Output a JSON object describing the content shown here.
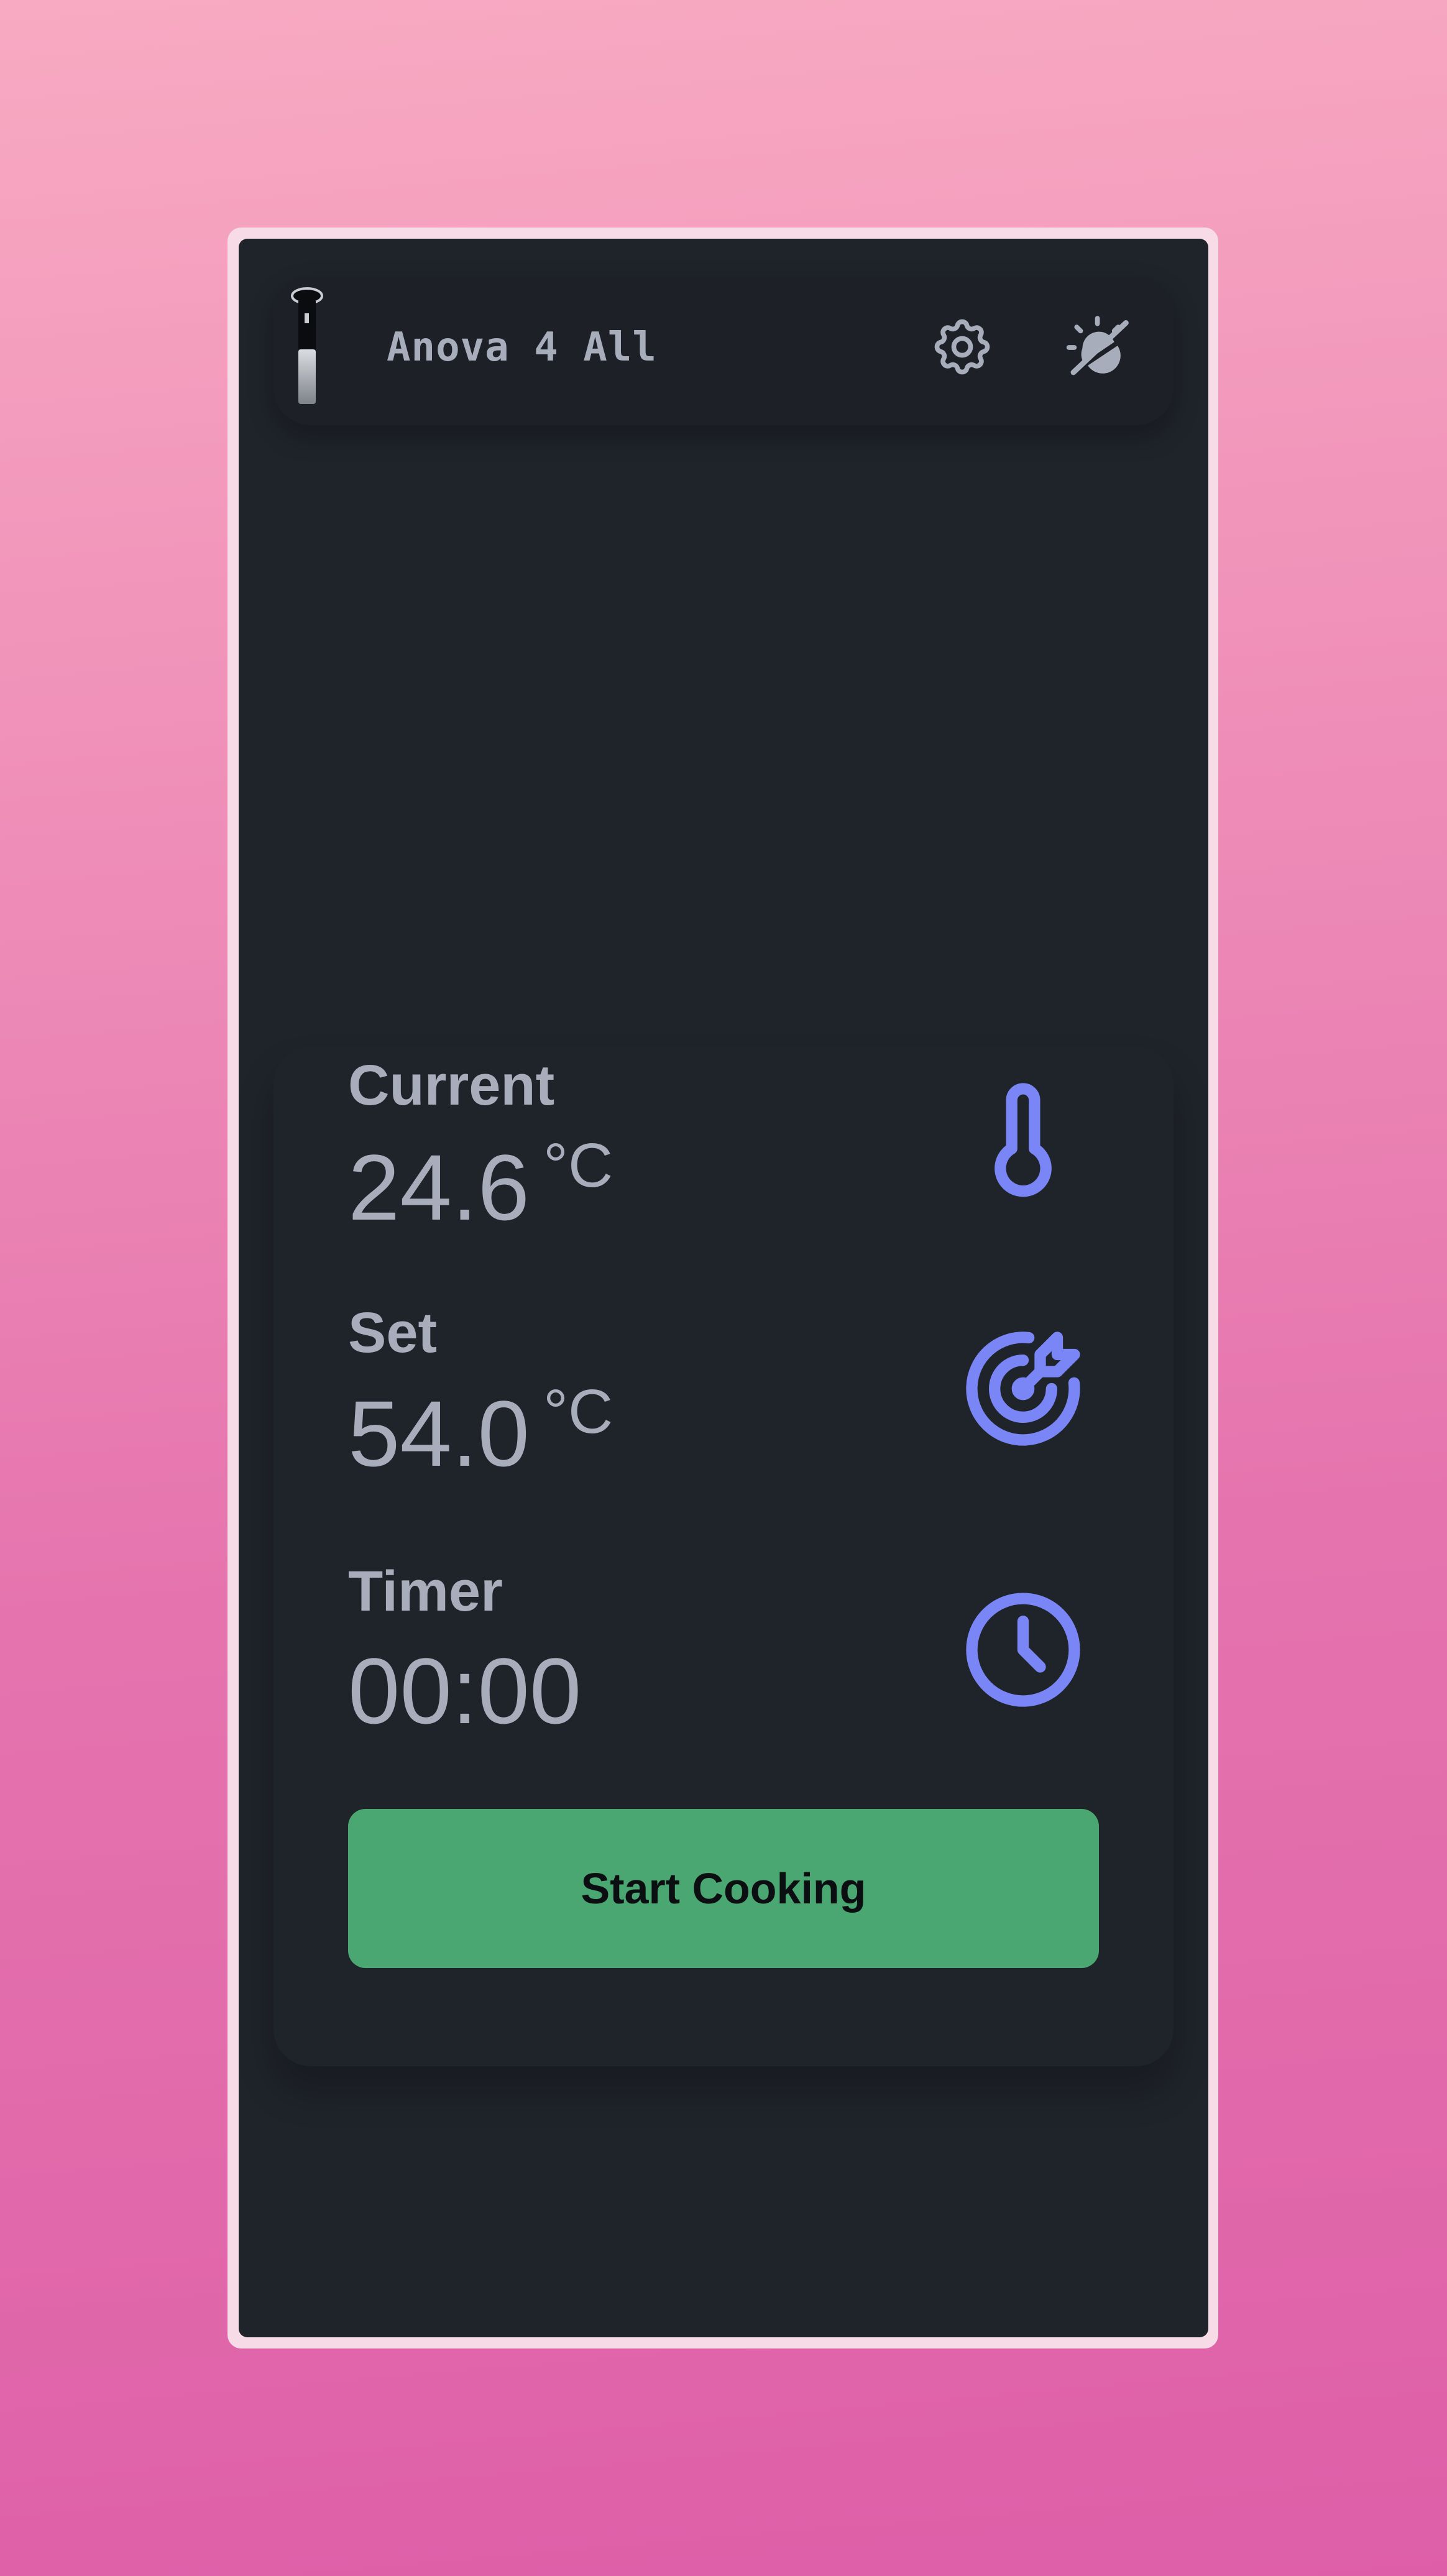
{
  "header": {
    "title": "Anova 4 All",
    "settings_icon": "gear-icon",
    "theme_icon": "theme-toggle-icon"
  },
  "stats": {
    "current": {
      "label": "Current",
      "value": "24.6",
      "unit": "°C",
      "icon": "thermometer-icon"
    },
    "set": {
      "label": "Set",
      "value": "54.0",
      "unit": "°C",
      "icon": "target-icon"
    },
    "timer": {
      "label": "Timer",
      "value": "00:00",
      "icon": "clock-icon"
    }
  },
  "actions": {
    "start_label": "Start Cooking"
  },
  "colors": {
    "accent": "#7a86f5",
    "start_button": "#4aa772",
    "text": "#a8adbb",
    "background": "#1f232a"
  }
}
